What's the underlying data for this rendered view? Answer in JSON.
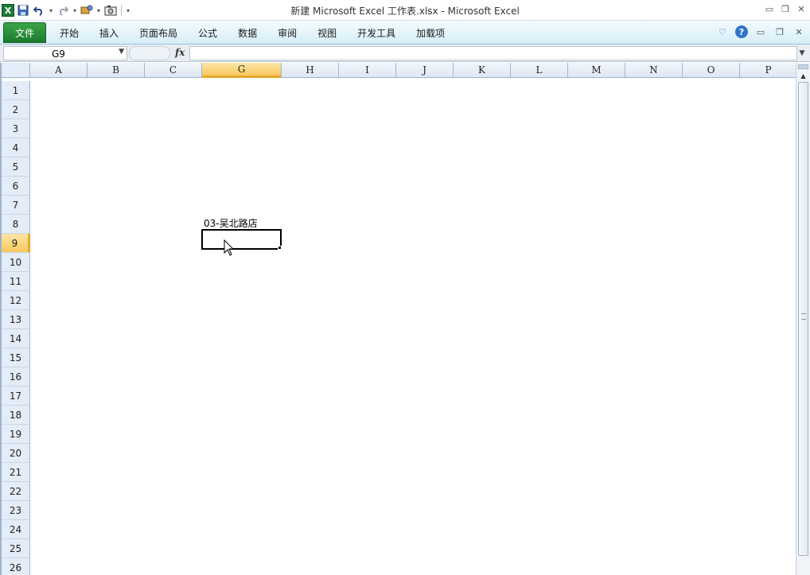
{
  "window": {
    "title": "新建 Microsoft Excel 工作表.xlsx  -  Microsoft Excel",
    "app_icon_letter": "X"
  },
  "ribbon": {
    "file_tab": "文件",
    "tabs": [
      "开始",
      "插入",
      "页面布局",
      "公式",
      "数据",
      "审阅",
      "视图",
      "开发工具",
      "加载项"
    ]
  },
  "formula_bar": {
    "name_box": "G9",
    "fx_label": "fx",
    "formula_value": ""
  },
  "sheet": {
    "columns": [
      "A",
      "B",
      "C",
      "G",
      "H",
      "I",
      "J",
      "K",
      "L",
      "M",
      "N",
      "O",
      "P"
    ],
    "selected_column": "G",
    "rows": [
      "1",
      "2",
      "3",
      "4",
      "5",
      "6",
      "7",
      "8",
      "9",
      "10",
      "11",
      "12",
      "13",
      "14",
      "15",
      "16",
      "17",
      "18",
      "19",
      "20",
      "21",
      "22",
      "23",
      "24",
      "25",
      "26"
    ],
    "selected_row": "9",
    "cells": {
      "G8": "03-吴北路店",
      "G9": ""
    }
  },
  "colors": {
    "file_tab": "#1d7a2e",
    "ribbon_bg": "#d7eef8",
    "header_bg": "#e4ecf7",
    "selected_header": "#f8c75e"
  }
}
